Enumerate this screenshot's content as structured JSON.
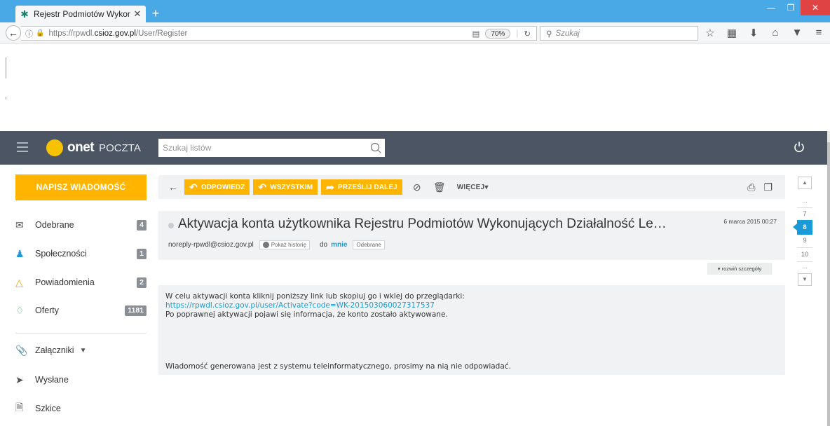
{
  "browser": {
    "tab_title": "Rejestr Podmiotów Wykonuj",
    "tab_close": "✕",
    "new_tab": "+",
    "url_prefix": "https://rpwdl.",
    "url_host": "csioz.gov.pl",
    "url_path": "/User/Register",
    "zoom": "70%",
    "search_placeholder": "Szukaj"
  },
  "header": {
    "brand": "onet",
    "product": "POCZTA",
    "search_placeholder": "Szukaj listów"
  },
  "sidebar": {
    "compose_label": "NAPISZ WIADOMOŚĆ",
    "items": [
      {
        "label": "Odebrane",
        "badge": "4",
        "icon": "envelope-icon"
      },
      {
        "label": "Społeczności",
        "badge": "1",
        "icon": "people-icon"
      },
      {
        "label": "Powiadomienia",
        "badge": "2",
        "icon": "bell-icon"
      },
      {
        "label": "Oferty",
        "badge": "1181",
        "icon": "tag-icon"
      },
      {
        "label": "Załączniki",
        "icon": "paperclip-icon"
      },
      {
        "label": "Wysłane",
        "icon": "send-icon"
      },
      {
        "label": "Szkice",
        "icon": "draft-icon"
      }
    ]
  },
  "toolbar": {
    "reply": "ODPOWIEDZ",
    "reply_all": "WSZYSTKIM",
    "forward": "PRZEŚLIJ DALEJ",
    "more": "WIĘCEJ"
  },
  "message": {
    "subject": "Aktywacja konta użytkownika Rejestru Podmiotów Wykonujących Działalność Le…",
    "date": "6 marca 2015 00:27",
    "from": "noreply-rpwdl@csioz.gov.pl",
    "history_btn": "Pokaż historię",
    "to_label": "do",
    "to_value": "mnie",
    "folder_tag": "Odebrane",
    "details_toggle": "rozwiń szczegóły",
    "body_line1": "W celu aktywacji konta kliknij poniższy link lub skopiuj go i wklej do przeglądarki:",
    "body_link": "https://rpwdl.csioz.gov.pl/user/Activate?code=WK-201503060027317537",
    "body_line3": "Po poprawnej aktywacji pojawi się informacja, że konto zostało aktywowane.",
    "body_footer": "Wiadomość generowana jest z systemu teleinformatycznego, prosimy na nią nie odpowiadać."
  },
  "pager": {
    "dots_top": "...",
    "items": [
      "7",
      "8",
      "9",
      "10"
    ],
    "active": "8",
    "dots_bottom": "..."
  },
  "colors": {
    "accent": "#ffb400",
    "header_bg": "#4b5563",
    "link": "#1a9bd7",
    "browser_tabbar": "#49a8e6"
  }
}
